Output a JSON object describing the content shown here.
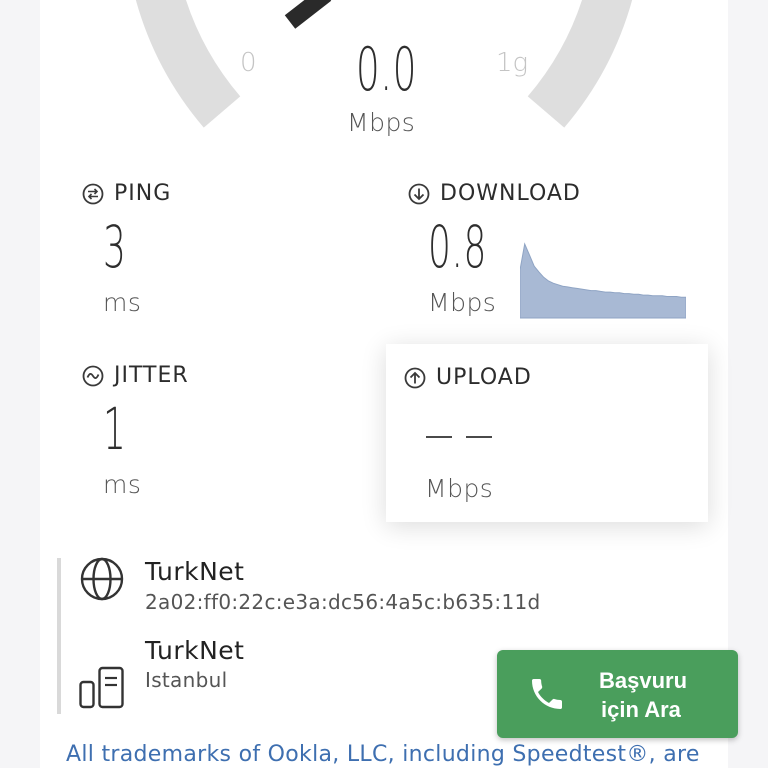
{
  "gauge": {
    "scale_min": "0",
    "scale_max": "1g",
    "value": "0.0",
    "unit": "Mbps",
    "colors": {
      "track": "#dedede",
      "needle": "#2a2a2a"
    }
  },
  "metrics": {
    "ping": {
      "title": "PING",
      "value": "3",
      "unit": "ms",
      "icon": "ping-icon"
    },
    "download": {
      "title": "DOWNLOAD",
      "value": "0.8",
      "unit": "Mbps",
      "icon": "download-arrow-icon",
      "sparkline_color": "#a8b9d4",
      "sparkline": [
        0.65,
        1.0,
        0.85,
        0.7,
        0.62,
        0.55,
        0.5,
        0.47,
        0.45,
        0.43,
        0.42,
        0.41,
        0.4,
        0.39,
        0.38,
        0.37,
        0.37,
        0.36,
        0.35,
        0.35,
        0.34,
        0.34,
        0.33,
        0.33,
        0.32,
        0.32,
        0.31,
        0.31,
        0.3,
        0.3,
        0.3,
        0.29,
        0.29,
        0.29,
        0.28,
        0.28
      ]
    },
    "jitter": {
      "title": "JITTER",
      "value": "1",
      "unit": "ms",
      "icon": "jitter-icon"
    },
    "upload": {
      "title": "UPLOAD",
      "value": "",
      "unit": "Mbps",
      "icon": "upload-arrow-icon"
    }
  },
  "connection": {
    "isp": {
      "name": "TurkNet",
      "address": "2a02:ff0:22c:e3a:dc56:4a5c:b635:11d",
      "icon": "globe-icon"
    },
    "server": {
      "name": "TurkNet",
      "location": "Istanbul",
      "icon": "server-icon"
    }
  },
  "call_button": {
    "line1": "Başvuru",
    "line2": "için Ara",
    "color": "#4a9e5c",
    "icon": "phone-icon"
  },
  "footer": {
    "text": "All trademarks of Ookla, LLC, including Speedtest®, are"
  }
}
